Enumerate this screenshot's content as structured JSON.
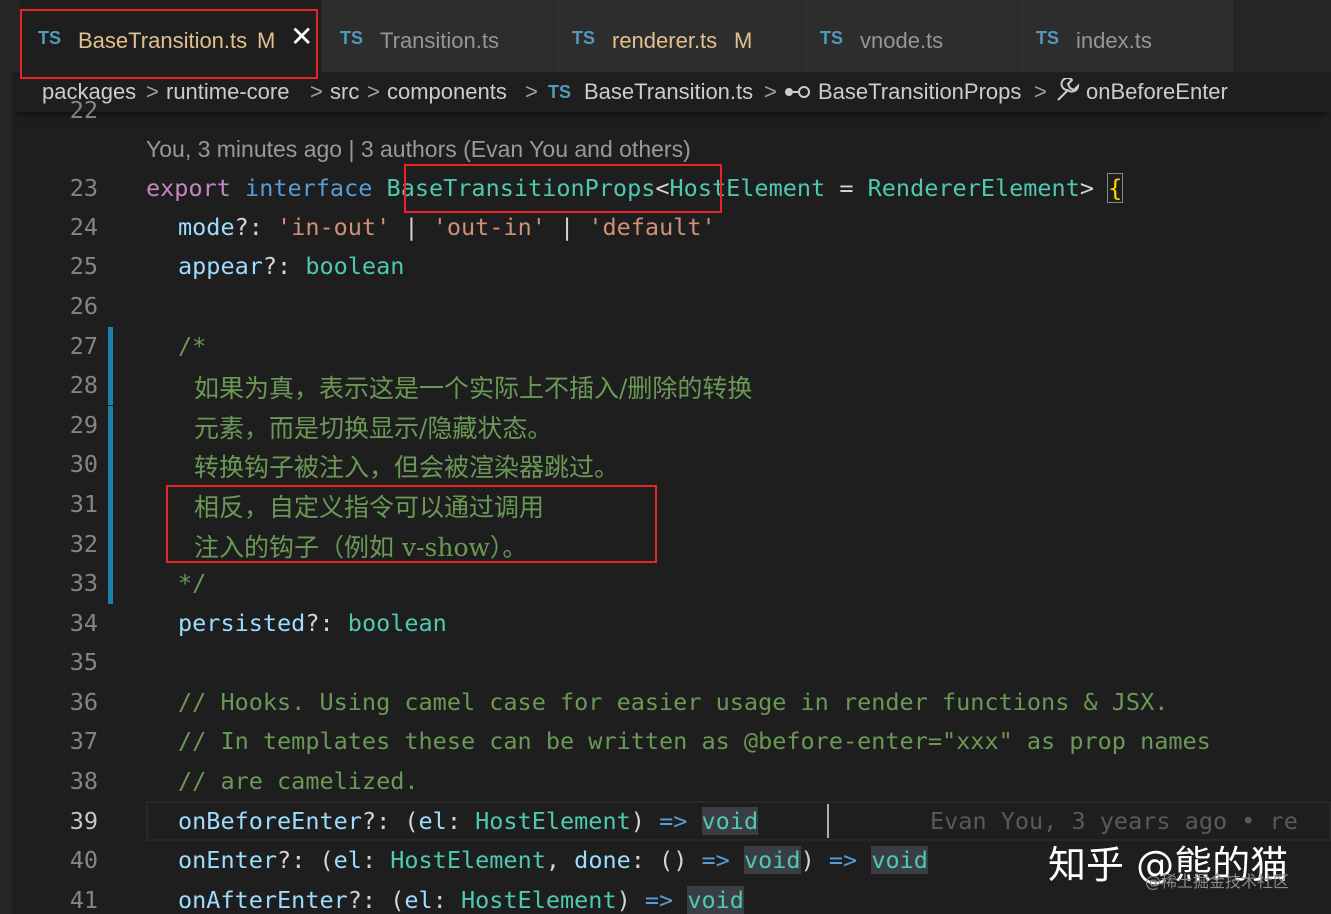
{
  "tabs": [
    {
      "ts": "TS",
      "name": "BaseTransition.ts",
      "badge": "M",
      "close": "✕"
    },
    {
      "ts": "TS",
      "name": "Transition.ts"
    },
    {
      "ts": "TS",
      "name": "renderer.ts",
      "badge": "M"
    },
    {
      "ts": "TS",
      "name": "vnode.ts"
    },
    {
      "ts": "TS",
      "name": "index.ts"
    }
  ],
  "breadcrumb": {
    "items": [
      "packages",
      "runtime-core",
      "src",
      "components",
      "BaseTransition.ts",
      "BaseTransitionProps",
      "onBeforeEnter"
    ],
    "ts": "TS",
    "sep": ">"
  },
  "blame": {
    "top": "You, 3 minutes ago | 3 authors (Evan You and others)",
    "inline": "Evan You, 3 years ago • re"
  },
  "code": {
    "line_numbers": [
      "22",
      "23",
      "24",
      "25",
      "26",
      "27",
      "28",
      "29",
      "30",
      "31",
      "32",
      "33",
      "34",
      "35",
      "36",
      "37",
      "38",
      "39",
      "40",
      "41"
    ],
    "l23": {
      "export": "export",
      "interface": "interface",
      "name": "BaseTransitionProps",
      "lt": "<",
      "host": "HostElement",
      "eq": " = ",
      "renderer": "RendererElement",
      "gt": ">",
      "brace": "{"
    },
    "l24": {
      "prop": "mode",
      "q": "?: ",
      "s1": "'in-out'",
      "bar1": " | ",
      "s2": "'out-in'",
      "bar2": " | ",
      "s3": "'default'"
    },
    "l25": {
      "prop": "appear",
      "q": "?: ",
      "type": "boolean"
    },
    "l27": "/*",
    "l28": "如果为真，表示这是一个实际上不插入/删除的转换",
    "l29": "元素，而是切换显示/隐藏状态。",
    "l30": "转换钩子被注入，但会被渲染器跳过。",
    "l31": "相反，自定义指令可以通过调用",
    "l32": "注入的钩子（例如 v-show）。",
    "l33": "*/",
    "l34": {
      "prop": "persisted",
      "q": "?: ",
      "type": "boolean"
    },
    "l36": "// Hooks. Using camel case for easier usage in render functions & JSX.",
    "l37": "// In templates these can be written as @before-enter=\"xxx\" as prop names",
    "l38": "// are camelized.",
    "l39": {
      "prop": "onBeforeEnter",
      "q": "?: (",
      "el": "el",
      "colon": ": ",
      "host": "HostElement",
      "close": ") ",
      "arrow": "=>",
      "sp": " ",
      "void": "void"
    },
    "l40": {
      "prop": "onEnter",
      "q": "?: (",
      "el": "el",
      "colon": ": ",
      "host": "HostElement",
      "comma": ", ",
      "done": "done",
      "colon2": ": () ",
      "arrow": "=>",
      "sp": " ",
      "void": "void",
      "close": ") ",
      "arrow2": "=>",
      "sp2": " ",
      "void2": "void"
    },
    "l41": {
      "prop": "onAfterEnter",
      "q": "?: (",
      "el": "el",
      "colon": ": ",
      "host": "HostElement",
      "close": ") ",
      "arrow": "=>",
      "sp": " ",
      "void": "void"
    }
  },
  "watermark": {
    "main": "知乎 @熊的猫",
    "sub": "@稀土掘金技术社区"
  },
  "colors": {
    "accent_red": "#e8242b",
    "ts_blue": "#519aba",
    "modified": "#e2c08d"
  }
}
